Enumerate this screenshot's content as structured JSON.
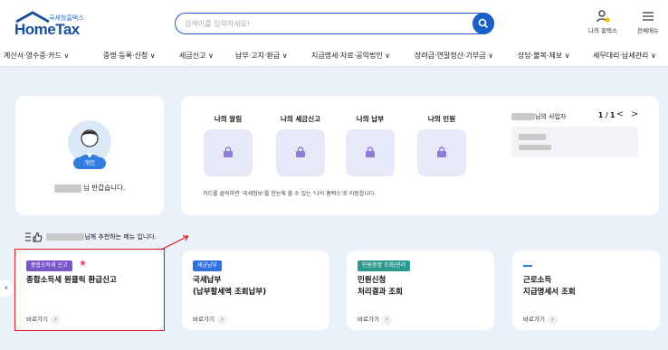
{
  "header": {
    "logo_sub": "국세청홈택스",
    "logo_main": "HomeTax",
    "search_placeholder": "검색어를 입력하세요!",
    "my_home": "나의 홈택스",
    "all_menu": "전체메뉴"
  },
  "gnb": [
    "계산서·영수증·카드 ∨",
    "증명·등록·신청 ∨",
    "세금신고 ∨",
    "납부·고지·환급 ∨",
    "지급명세·자료·공익법인 ∨",
    "장려금·연말정산·기부금 ∨",
    "상담·불복·제보 ∨",
    "세무대리·납세관리 ∨"
  ],
  "profile": {
    "badge": "개인",
    "greeting_suffix": "님 반갑습니다."
  },
  "alerts": {
    "items": [
      "나의 알림",
      "나의 세금신고",
      "나의 납부",
      "나의 민원"
    ],
    "note": "카드를 클릭하면 '국세정보'를 한눈에 볼 수 있는 '나의 홈택스'로 이동합니다."
  },
  "business": {
    "title_suffix": "님의 사업자",
    "page": "1 / 1",
    "prev": "<",
    "next": ">"
  },
  "recommend": {
    "title_suffix": "님께 추천하는 메뉴 입니다."
  },
  "menu_cards": [
    {
      "tag": "종합소득세 신고",
      "tag_color": "#7a55c8",
      "title1": "종합소득세 원클릭 환급신고",
      "title2": "",
      "go": "바로가기"
    },
    {
      "tag": "세금납부",
      "tag_color": "#2f6fe0",
      "title1": "국세납부",
      "title2": "(납부할세액 조회납부)",
      "go": "바로가기"
    },
    {
      "tag": "민원증명 조회/관리",
      "tag_color": "#2a9a8c",
      "title1": "민원신청",
      "title2": "처리결과 조회",
      "go": "바로가기"
    },
    {
      "tag": "",
      "tag_color": "#2f7de1",
      "title1": "근로소득",
      "title2": "지급명세서 조회",
      "go": "바로가기"
    }
  ],
  "colors": {
    "primary": "#1b5fc8",
    "highlight": "#e01b1b",
    "background": "#eaf1fa"
  }
}
